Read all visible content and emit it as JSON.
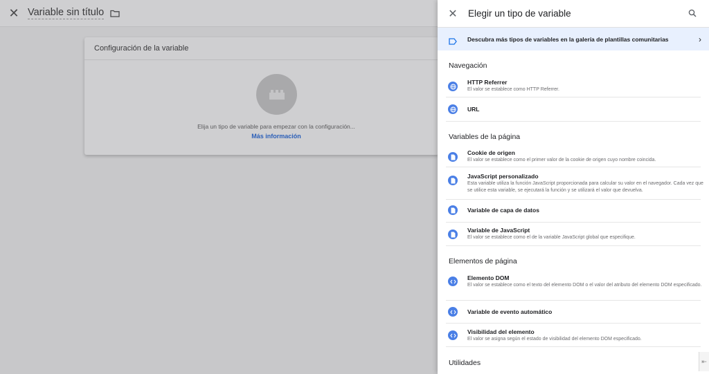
{
  "editor": {
    "close_icon": "close-icon",
    "title": "Variable sin título",
    "folder_icon": "folder-icon",
    "card_title": "Configuración de la variable",
    "placeholder_icon": "lego-brick-icon",
    "hint": "Elija un tipo de variable para empezar con la configuración...",
    "more_info": "Más información"
  },
  "panel": {
    "title": "Elegir un tipo de variable",
    "search_icon": "search-icon",
    "gallery_text": "Descubra más tipos de variables en la galería de plantillas comunitarias",
    "sections": [
      {
        "title": "Navegación",
        "items": [
          {
            "title": "HTTP Referrer",
            "desc": "El valor se establece como HTTP Referrer.",
            "icon": "globe-icon"
          },
          {
            "title": "URL",
            "desc": "",
            "icon": "globe-icon"
          }
        ]
      },
      {
        "title": "Variables de la página",
        "items": [
          {
            "title": "Cookie de origen",
            "desc": "El valor se establece como el primer valor de la cookie de origen cuyo nombre coincida.",
            "icon": "document-icon"
          },
          {
            "title": "JavaScript personalizado",
            "desc": "Esta variable utiliza la función JavaScript proporcionada para calcular su valor en el navegador. Cada vez que se utilice esta variable, se ejecutará la función y se utilizará el valor que devuelva.",
            "icon": "document-icon"
          },
          {
            "title": "Variable de capa de datos",
            "desc": "",
            "icon": "document-icon"
          },
          {
            "title": "Variable de JavaScript",
            "desc": "El valor se establece como el de la variable JavaScript global que especifique.",
            "icon": "document-icon"
          }
        ]
      },
      {
        "title": "Elementos de página",
        "items": [
          {
            "title": "Elemento DOM",
            "desc": "El valor se establece como el texto del elemento DOM o el valor del atributo del elemento DOM especificado.",
            "icon": "code-icon"
          },
          {
            "title": "Variable de evento automático",
            "desc": "",
            "icon": "code-icon"
          },
          {
            "title": "Visibilidad del elemento",
            "desc": "El valor se asigna según el estado de visibilidad del elemento DOM especificado.",
            "icon": "code-icon"
          }
        ]
      },
      {
        "title": "Utilidades",
        "items": []
      }
    ]
  },
  "colors": {
    "accent": "#4a7fe6",
    "banner_bg": "#e8f0fe",
    "link": "#2b5fb8"
  }
}
